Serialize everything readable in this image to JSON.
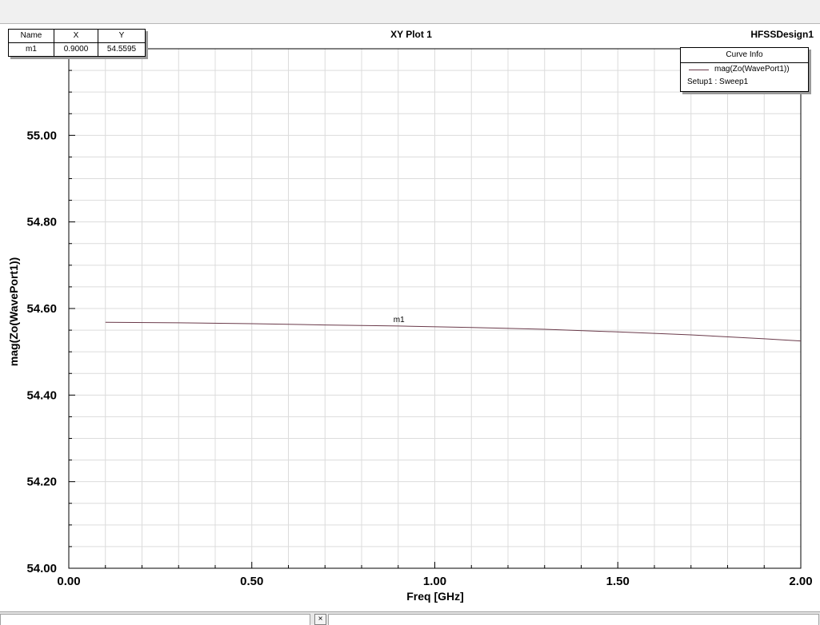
{
  "plot": {
    "title": "XY Plot 1",
    "design_name": "HFSSDesign1"
  },
  "marker_table": {
    "headers": [
      "Name",
      "X",
      "Y"
    ],
    "rows": [
      [
        "m1",
        "0.9000",
        "54.5595"
      ]
    ]
  },
  "curve_info": {
    "title": "Curve Info",
    "entries": [
      {
        "name": "mag(Zo(WavePort1))",
        "sub": "Setup1 : Sweep1",
        "color": "#6a3a4a"
      }
    ]
  },
  "chart_data": {
    "type": "line",
    "xlabel": "Freq [GHz]",
    "ylabel": "mag(Zo(WavePort1))",
    "xlim": [
      0,
      2
    ],
    "ylim": [
      54.0,
      55.2
    ],
    "x_ticks": [
      "0.00",
      "0.50",
      "1.00",
      "1.50",
      "2.00"
    ],
    "y_ticks": [
      "54.00",
      "54.20",
      "54.40",
      "54.60",
      "54.80",
      "55.00"
    ],
    "grid": true,
    "legend": "top-right",
    "series": [
      {
        "name": "mag(Zo(WavePort1))",
        "color": "#6a3a4a",
        "x": [
          0.1,
          0.3,
          0.5,
          0.7,
          0.9,
          1.1,
          1.3,
          1.5,
          1.7,
          1.9,
          2.0
        ],
        "y": [
          54.568,
          54.567,
          54.565,
          54.562,
          54.5595,
          54.556,
          54.552,
          54.546,
          54.539,
          54.53,
          54.525
        ]
      }
    ],
    "markers": [
      {
        "name": "m1",
        "x": 0.9,
        "y": 54.5595
      }
    ]
  }
}
